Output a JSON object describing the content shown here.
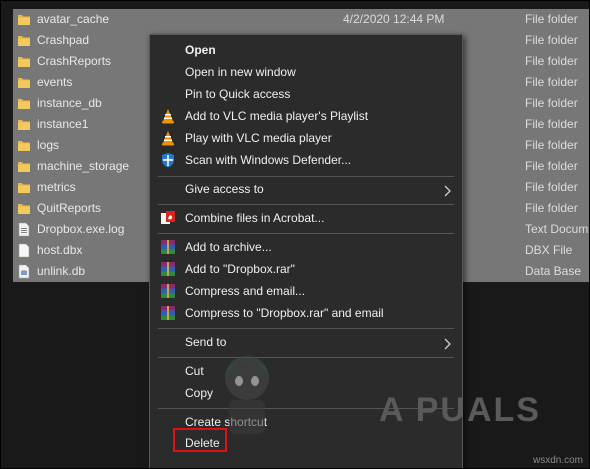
{
  "files": [
    {
      "name": "avatar_cache",
      "date": "4/2/2020 12:44 PM",
      "type": "File folder",
      "icon": "folder-icon"
    },
    {
      "name": "Crashpad",
      "date": "",
      "type": "File folder",
      "icon": "folder-icon"
    },
    {
      "name": "CrashReports",
      "date": "",
      "type": "File folder",
      "icon": "folder-icon"
    },
    {
      "name": "events",
      "date": "",
      "type": "File folder",
      "icon": "folder-icon"
    },
    {
      "name": "instance_db",
      "date": "",
      "type": "File folder",
      "icon": "folder-icon"
    },
    {
      "name": "instance1",
      "date": "",
      "type": "File folder",
      "icon": "folder-icon"
    },
    {
      "name": "logs",
      "date": "",
      "type": "File folder",
      "icon": "folder-icon"
    },
    {
      "name": "machine_storage",
      "date": "",
      "type": "File folder",
      "icon": "folder-icon"
    },
    {
      "name": "metrics",
      "date": "",
      "type": "File folder",
      "icon": "folder-icon"
    },
    {
      "name": "QuitReports",
      "date": "",
      "type": "File folder",
      "icon": "folder-icon"
    },
    {
      "name": "Dropbox.exe.log",
      "date": "",
      "type": "Text Docum",
      "icon": "text-file-icon"
    },
    {
      "name": "host.dbx",
      "date": "",
      "type": "DBX File",
      "icon": "file-icon"
    },
    {
      "name": "unlink.db",
      "date": "",
      "type": "Data Base",
      "icon": "database-file-icon"
    }
  ],
  "context_menu": {
    "open": "Open",
    "open_new_window": "Open in new window",
    "pin_quick_access": "Pin to Quick access",
    "add_vlc_playlist": "Add to VLC media player's Playlist",
    "play_vlc": "Play with VLC media player",
    "scan_defender": "Scan with Windows Defender...",
    "give_access": "Give access to",
    "combine_acrobat": "Combine files in Acrobat...",
    "add_archive": "Add to archive...",
    "add_dropbox_rar": "Add to \"Dropbox.rar\"",
    "compress_email": "Compress and email...",
    "compress_dropbox_email": "Compress to \"Dropbox.rar\" and email",
    "send_to": "Send to",
    "cut": "Cut",
    "copy": "Copy",
    "create_shortcut": "Create shortcut",
    "delete": "Delete"
  },
  "watermark": {
    "brand": "A PUALS",
    "site": "wsxdn.com"
  },
  "colors": {
    "background": "#191919",
    "selection": "#777777",
    "menu_bg": "#2b2b2b",
    "highlight_box": "#e01010",
    "folder": "#e8b84a"
  }
}
